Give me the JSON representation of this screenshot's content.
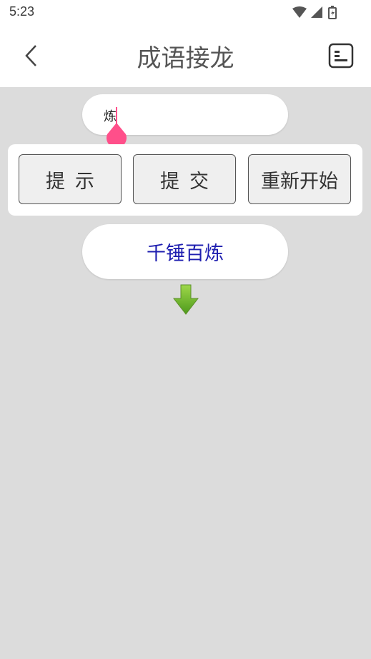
{
  "status_bar": {
    "time": "5:23",
    "icons": [
      "wifi-icon",
      "signal-icon",
      "battery-icon"
    ]
  },
  "app_bar": {
    "title": "成语接龙",
    "back_icon": "back-arrow-icon",
    "menu_icon": "list-icon"
  },
  "input": {
    "value": "炼"
  },
  "buttons": {
    "hint": "提示",
    "submit": "提交",
    "restart": "重新开始"
  },
  "chain": {
    "current_idiom": "千锤百炼"
  },
  "colors": {
    "background": "#dcdcdc",
    "idiom_text": "#1f1fb0",
    "cursor": "#ff4f8a",
    "arrow": "#6fb52c"
  }
}
